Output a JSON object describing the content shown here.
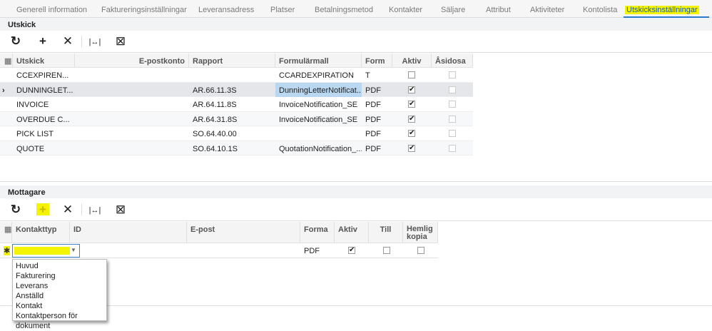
{
  "tabs": [
    "Generell information",
    "Faktureringsinställningar",
    "Leveransadress",
    "Platser",
    "Betalningsmetod",
    "Kontakter",
    "Säljare",
    "Attribut",
    "Aktiviteter",
    "Kontolista",
    "Utskicksinställningar"
  ],
  "active_tab": "Utskicksinställningar",
  "utskick": {
    "title": "Utskick",
    "columns": [
      "Utskick",
      "E-postkonto",
      "Rapport",
      "Formulärmall",
      "Form",
      "Aktiv",
      "Åsidosa"
    ],
    "rows": [
      {
        "utskick": "CCEXPIREN...",
        "epost": "",
        "rapport": "",
        "mall": "CCARDEXPIRATION",
        "form": "T",
        "aktiv": false,
        "asidosa": false
      },
      {
        "utskick": "DUNNINGLET...",
        "epost": "",
        "rapport": "AR.66.11.3S",
        "mall": "DunningLetterNotificat...",
        "form": "PDF",
        "aktiv": true,
        "asidosa": false
      },
      {
        "utskick": "INVOICE",
        "epost": "",
        "rapport": "AR.64.11.8S",
        "mall": "InvoiceNotification_SE",
        "form": "PDF",
        "aktiv": true,
        "asidosa": false
      },
      {
        "utskick": "OVERDUE C...",
        "epost": "",
        "rapport": "AR.64.31.8S",
        "mall": "InvoiceNotification_SE",
        "form": "PDF",
        "aktiv": true,
        "asidosa": false
      },
      {
        "utskick": "PICK LIST",
        "epost": "",
        "rapport": "SO.64.40.00",
        "mall": "",
        "form": "PDF",
        "aktiv": true,
        "asidosa": false
      },
      {
        "utskick": "QUOTE",
        "epost": "",
        "rapport": "SO.64.10.1S",
        "mall": "QuotationNotification_...",
        "form": "PDF",
        "aktiv": true,
        "asidosa": false
      }
    ]
  },
  "mottagare": {
    "title": "Mottagare",
    "columns": [
      "Kontakttyp",
      "ID",
      "E-post",
      "Forma",
      "Aktiv",
      "Till",
      "Hemlig kopia"
    ],
    "new_row": {
      "kontakttyp": "",
      "id": "",
      "epost": "",
      "forma": "PDF",
      "aktiv": true,
      "till": false,
      "hemlig": false
    },
    "dropdown_options": [
      "Huvud",
      "Fakturering",
      "Leverans",
      "Anställd",
      "Kontakt",
      "Kontaktperson för dokument"
    ]
  },
  "icons": {
    "refresh": "↻",
    "add": "+",
    "delete": "✕",
    "fit": "|↔|",
    "export": "⊠"
  },
  "colors": {
    "highlight": "#f4f400",
    "accent": "#2a7ad4",
    "selected_cell": "#b9d7f0"
  }
}
